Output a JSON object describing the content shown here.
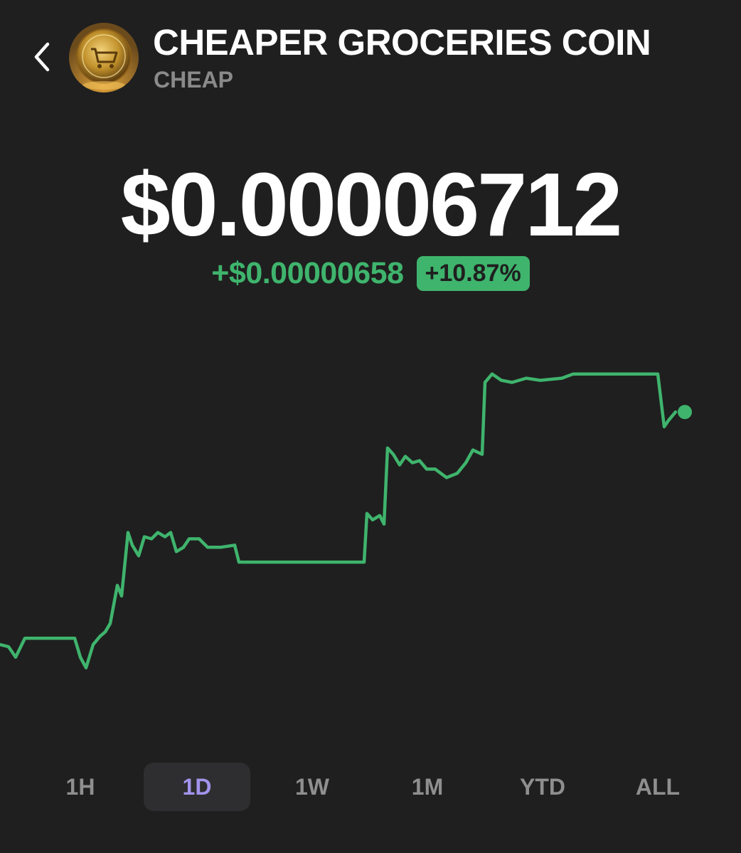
{
  "header": {
    "coin_name": "CHEAPER GROCERIES COIN",
    "ticker": "CHEAP"
  },
  "price": {
    "current": "$0.00006712",
    "change_abs": "+$0.00000658",
    "change_pct": "+10.87%"
  },
  "colors": {
    "background": "#1f1f1f",
    "positive": "#3fb46d",
    "selected_range": "#a393ec",
    "muted": "#8a8a8a"
  },
  "ranges": {
    "items": [
      "1H",
      "1D",
      "1W",
      "1M",
      "YTD",
      "ALL"
    ],
    "selected": "1D"
  },
  "chart_data": {
    "type": "line",
    "title": "",
    "xlabel": "",
    "ylabel": "",
    "grid": false,
    "legend": "none",
    "series": [
      {
        "values": [
          5.8e-05,
          5.8e-05,
          5.78e-05,
          5.79e-05,
          5.74e-05,
          5.83e-05,
          5.83e-05,
          5.83e-05,
          5.83e-05,
          5.83e-05,
          5.83e-05,
          5.83e-05,
          5.83e-05,
          5.83e-05,
          5.83e-05,
          5.83e-05,
          5.83e-05,
          5.83e-05,
          5.83e-05,
          5.83e-05,
          5.83e-05,
          5.83e-05,
          5.83e-05,
          5.76e-05,
          5.74e-05,
          5.7e-05,
          5.75e-05,
          5.82e-05,
          5.85e-05,
          5.85e-05,
          5.88e-05,
          5.88e-05,
          5.9e-05,
          5.88e-05,
          5.98e-05,
          6.03e-05,
          6.07e-05,
          6.03e-05,
          6.3e-05,
          6.32e-05,
          6.21e-05,
          6.32e-05,
          6.22e-05,
          6.28e-05,
          6.26e-05,
          6.29e-05,
          6.28e-05,
          6.3e-05,
          6.3e-05,
          6.27e-05,
          6.22e-05,
          6.26e-05,
          6.25e-05,
          6.28e-05,
          6.29e-05,
          6.24e-05,
          6.24e-05,
          6.24e-05,
          6.24e-05,
          6.24e-05,
          6.24e-05,
          6.24e-05,
          6.24e-05,
          6.24e-05,
          6.2e-05,
          6.2e-05,
          6.2e-05,
          6.2e-05,
          6.2e-05,
          6.2e-05,
          6.2e-05,
          6.2e-05,
          6.2e-05,
          6.2e-05,
          6.2e-05,
          6.2e-05,
          6.2e-05,
          6.2e-05,
          6.2e-05,
          6.2e-05,
          6.2e-05,
          6.2e-05,
          6.2e-05,
          6.2e-05,
          6.2e-05,
          6.2e-05,
          6.2e-05,
          6.2e-05,
          6.2e-05,
          6.2e-05,
          6.2e-05,
          6.2e-05,
          6.2e-05,
          6.2e-05,
          6.2e-05,
          6.2e-05,
          6.2e-05,
          6.2e-05,
          6.2e-05,
          6.2e-05,
          6.2e-05,
          6.2e-05,
          6.2e-05,
          6.2e-05,
          6.2e-05,
          6.2e-05,
          6.2e-05,
          6.2e-05,
          6.2e-05,
          6.2e-05,
          6.2e-05,
          6.2e-05,
          6.2e-05,
          6.2e-05,
          6.2e-05,
          6.2e-05,
          6.2e-05,
          6.2e-05,
          6.2e-05,
          6.2e-05,
          6.2e-05,
          6.2e-05,
          6.2e-05,
          6.2e-05,
          6.2e-05,
          6.2e-05,
          6.2e-05,
          6.2e-05,
          6.2e-05,
          6.2e-05,
          6.2e-05,
          6.2e-05,
          6.2e-05,
          6.2e-05,
          6.2e-05,
          6.2e-05,
          6.2e-05,
          6.2e-05,
          6.2e-05,
          6.2e-05,
          6.2e-05,
          6.2e-05,
          6.2e-05,
          6.2e-05,
          6.2e-05,
          6.2e-05,
          6.2e-05,
          6.2e-05,
          6.2e-05,
          6.2e-05,
          6.2e-05,
          6.2e-05,
          6.2e-05,
          6.2e-05,
          6.2e-05,
          6.2e-05,
          6.2e-05,
          6.2e-05,
          6.2e-05,
          6.2e-05,
          6.2e-05,
          6.2e-05,
          6.2e-05,
          6.2e-05,
          6.2e-05,
          6.2e-05,
          6.2e-05,
          6.2e-05,
          6.2e-05,
          6.2e-05,
          6.2e-05,
          6.2e-05,
          6.2e-05,
          6.2e-05,
          6.2e-05,
          6.2e-05,
          6.2e-05,
          6.2e-05,
          6.2e-05,
          6.2e-05,
          6.2e-05,
          6.2e-05,
          6.2e-05,
          6.2e-05,
          6.2e-05,
          6.2e-05,
          6.2e-05,
          6.2e-05,
          6.2e-05,
          6.2e-05,
          6.2e-05,
          6.2e-05,
          6.2e-05,
          6.2e-05,
          6.2e-05,
          6.2e-05,
          6.2e-05,
          6.2e-05,
          6.2e-05,
          6.2e-05,
          6.2e-05,
          6.2e-05,
          6.2e-05,
          6.2e-05,
          6.2e-05,
          6.2e-05,
          6.2e-05,
          6.2e-05,
          6.2e-05,
          6.2e-05,
          6.2e-05,
          6.2e-05,
          6.2e-05,
          6.2e-05,
          6.2e-05,
          6.2e-05,
          6.2e-05,
          6.2e-05,
          6.2e-05,
          6.2e-05,
          6.2e-05,
          6.2e-05,
          6.2e-05,
          6.2e-05,
          6.2e-05,
          6.2e-05,
          6.2e-05,
          6.2e-05,
          6.2e-05,
          6.2e-05,
          6.2e-05,
          6.2e-05,
          6.2e-05,
          6.2e-05,
          6.2e-05,
          6.2e-05,
          6.2e-05,
          6.2e-05,
          6.2e-05,
          6.2e-05,
          6.2e-05,
          6.2e-05,
          6.2e-05,
          6.2e-05,
          6.2e-05,
          6.2e-05,
          6.2e-05,
          6.2e-05
        ]
      }
    ],
    "points": [
      [
        0,
        5.8e-05
      ],
      [
        12,
        5.79e-05
      ],
      [
        22,
        5.74e-05
      ],
      [
        35,
        5.83e-05
      ],
      [
        105,
        5.83e-05
      ],
      [
        113,
        5.74e-05
      ],
      [
        121,
        5.69e-05
      ],
      [
        131,
        5.8e-05
      ],
      [
        141,
        5.84e-05
      ],
      [
        148,
        5.86e-05
      ],
      [
        155,
        5.9e-05
      ],
      [
        165,
        6.08e-05
      ],
      [
        171,
        6.03e-05
      ],
      [
        180,
        6.33e-05
      ],
      [
        186,
        6.27e-05
      ],
      [
        195,
        6.22e-05
      ],
      [
        203,
        6.31e-05
      ],
      [
        213,
        6.3e-05
      ],
      [
        222,
        6.33e-05
      ],
      [
        232,
        6.31e-05
      ],
      [
        240,
        6.33e-05
      ],
      [
        248,
        6.24e-05
      ],
      [
        258,
        6.26e-05
      ],
      [
        266,
        6.3e-05
      ],
      [
        280,
        6.3e-05
      ],
      [
        292,
        6.26e-05
      ],
      [
        310,
        6.26e-05
      ],
      [
        330,
        6.27e-05
      ],
      [
        336,
        6.19e-05
      ],
      [
        512,
        6.19e-05
      ],
      [
        516,
        6.42e-05
      ],
      [
        524,
        6.39e-05
      ],
      [
        534,
        6.41e-05
      ],
      [
        540,
        6.37e-05
      ],
      [
        545,
        6.73e-05
      ],
      [
        553,
        6.7e-05
      ],
      [
        562,
        6.65e-05
      ],
      [
        570,
        6.69e-05
      ],
      [
        580,
        6.66e-05
      ],
      [
        590,
        6.67e-05
      ],
      [
        600,
        6.63e-05
      ],
      [
        612,
        6.63e-05
      ],
      [
        628,
        6.59e-05
      ],
      [
        643,
        6.61e-05
      ],
      [
        655,
        6.66e-05
      ],
      [
        665,
        6.72e-05
      ],
      [
        678,
        6.7e-05
      ],
      [
        682,
        7.04e-05
      ],
      [
        692,
        7.08e-05
      ],
      [
        705,
        7.05e-05
      ],
      [
        720,
        7.04e-05
      ],
      [
        740,
        7.06e-05
      ],
      [
        760,
        7.05e-05
      ],
      [
        790,
        7.06e-05
      ],
      [
        806,
        7.08e-05
      ],
      [
        925,
        7.08e-05
      ],
      [
        934,
        6.83e-05
      ],
      [
        940,
        6.86e-05
      ],
      [
        950,
        6.9e-05
      ]
    ],
    "last_point": [
      963,
      6.9e-05
    ],
    "ylim": [
      5.45e-05,
      7.2e-05
    ]
  }
}
